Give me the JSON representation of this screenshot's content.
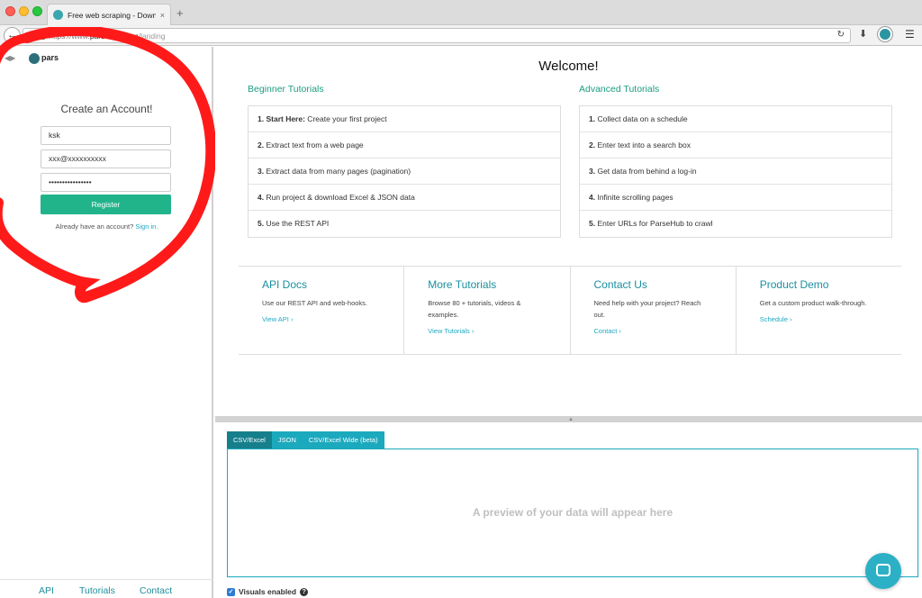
{
  "browser": {
    "tab_title": "Free web scraping - Downloa",
    "tab_close": "×",
    "new_tab": "+",
    "back": "←",
    "url_prefix": "https://www.",
    "url_host": "parsehub.com",
    "url_path": "/landing",
    "reload": "↻",
    "download": "⬇",
    "menu": "☰"
  },
  "sidebar": {
    "nav_arrows": "◀▶",
    "brand": "pars",
    "form_title": "Create an Account!",
    "username_value": "ksk",
    "email_value": "xxx@xxxxxxxxxx",
    "password_value": "••••••••••••••••",
    "register_label": "Register",
    "have_account_text": "Already have an account? ",
    "signin_label": "Sign in.",
    "footer_links": [
      "API",
      "Tutorials",
      "Contact"
    ]
  },
  "main": {
    "welcome": "Welcome!",
    "beginner_heading": "Beginner Tutorials",
    "advanced_heading": "Advanced Tutorials",
    "beginner": [
      {
        "num": "1.",
        "bold": "Start Here:",
        "text": " Create your first project"
      },
      {
        "num": "2.",
        "bold": "",
        "text": "Extract text from a web page"
      },
      {
        "num": "3.",
        "bold": "",
        "text": "Extract data from many pages (pagination)"
      },
      {
        "num": "4.",
        "bold": "",
        "text": "Run project & download Excel & JSON data"
      },
      {
        "num": "5.",
        "bold": "",
        "text": "Use the REST API"
      }
    ],
    "advanced": [
      {
        "num": "1.",
        "text": "Collect data on a schedule"
      },
      {
        "num": "2.",
        "text": "Enter text into a search box"
      },
      {
        "num": "3.",
        "text": "Get data from behind a log-in"
      },
      {
        "num": "4.",
        "text": "Infinite scrolling pages"
      },
      {
        "num": "5.",
        "text": "Enter URLs for ParseHub to crawl"
      }
    ],
    "cards": [
      {
        "title": "API Docs",
        "desc": "Use our REST API and web-hooks.",
        "link": "View API ›"
      },
      {
        "title": "More Tutorials",
        "desc": "Browse 80 + tutorials, videos & examples.",
        "link": "View Tutorials ›"
      },
      {
        "title": "Contact Us",
        "desc": "Need help with your project? Reach out.",
        "link": "Contact ›"
      },
      {
        "title": "Product Demo",
        "desc": "Get a custom product walk-through.",
        "link": "Schedule ›"
      }
    ]
  },
  "preview": {
    "grip": "▲",
    "tabs": [
      "CSV/Excel",
      "JSON",
      "CSV/Excel Wide (beta)"
    ],
    "active_tab": "CSV/Excel",
    "placeholder": "A preview of your data will appear here",
    "visuals_label": "Visuals enabled",
    "visuals_checked": true,
    "checkmark": "✓",
    "help": "?"
  },
  "icons": {
    "back": "arrow-left-icon",
    "info": "info-icon",
    "lock": "lock-icon",
    "chat": "chat-bubble-icon"
  },
  "colors": {
    "accent_green": "#21b48b",
    "accent_teal": "#1ba9bd",
    "annotation_red": "#ff1a1a"
  }
}
